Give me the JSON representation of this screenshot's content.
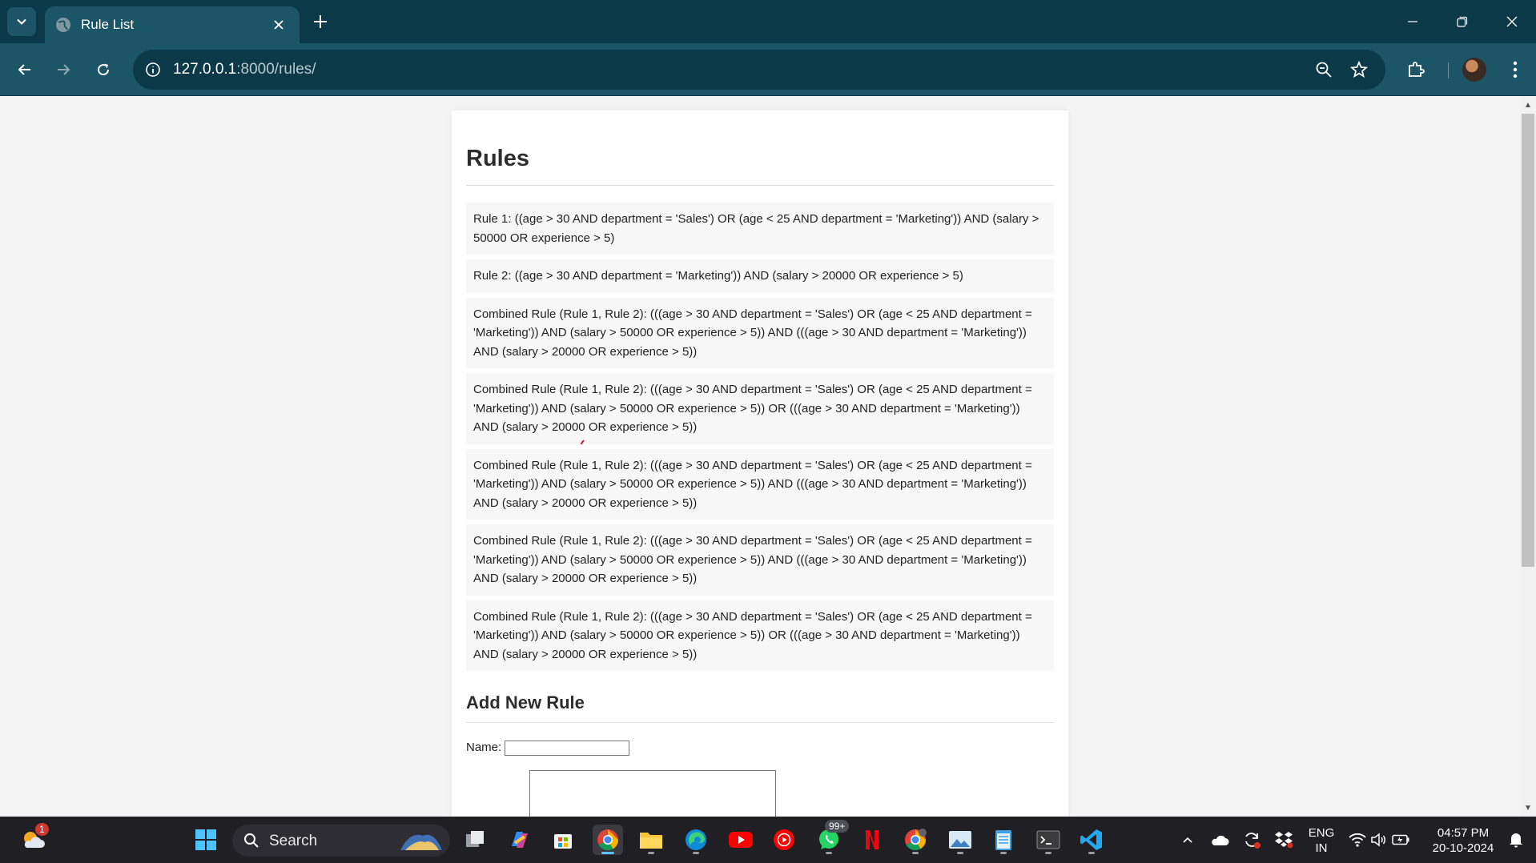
{
  "browser": {
    "tab": {
      "title": "Rule List"
    },
    "address": {
      "host": "127.0.0.1",
      "rest": ":8000/rules/"
    }
  },
  "page": {
    "title": "Rules",
    "rules": [
      "Rule 1: ((age > 30 AND department = 'Sales') OR (age < 25 AND department = 'Marketing')) AND (salary > 50000 OR experience > 5)",
      "Rule 2: ((age > 30 AND department = 'Marketing')) AND (salary > 20000 OR experience > 5)",
      "Combined Rule (Rule 1, Rule 2): (((age > 30 AND department = 'Sales') OR (age < 25 AND department = 'Marketing')) AND (salary > 50000 OR experience > 5)) AND (((age > 30 AND department = 'Marketing')) AND (salary > 20000 OR experience > 5))",
      "Combined Rule (Rule 1, Rule 2): (((age > 30 AND department = 'Sales') OR (age < 25 AND department = 'Marketing')) AND (salary > 50000 OR experience > 5)) OR (((age > 30 AND department = 'Marketing')) AND (salary > 20000 OR experience > 5))",
      "Combined Rule (Rule 1, Rule 2): (((age > 30 AND department = 'Sales') OR (age < 25 AND department = 'Marketing')) AND (salary > 50000 OR experience > 5)) AND (((age > 30 AND department = 'Marketing')) AND (salary > 20000 OR experience > 5))",
      "Combined Rule (Rule 1, Rule 2): (((age > 30 AND department = 'Sales') OR (age < 25 AND department = 'Marketing')) AND (salary > 50000 OR experience > 5)) AND (((age > 30 AND department = 'Marketing')) AND (salary > 20000 OR experience > 5))",
      "Combined Rule (Rule 1, Rule 2): (((age > 30 AND department = 'Sales') OR (age < 25 AND department = 'Marketing')) AND (salary > 50000 OR experience > 5)) OR (((age > 30 AND department = 'Marketing')) AND (salary > 20000 OR experience > 5))"
    ],
    "add_rule": {
      "heading": "Add New Rule",
      "name_label": "Name:",
      "name_value": "",
      "expression_value": ""
    }
  },
  "taskbar": {
    "search_label": "Search",
    "weather_badge": "1",
    "whatsapp_badge": "99+",
    "lang_line1": "ENG",
    "lang_line2": "IN",
    "time": "04:57 PM",
    "date": "20-10-2024"
  },
  "colors": {
    "chrome_dark": "#0b3947",
    "chrome_light": "#1c5566",
    "taskbar": "#1f1f24"
  }
}
